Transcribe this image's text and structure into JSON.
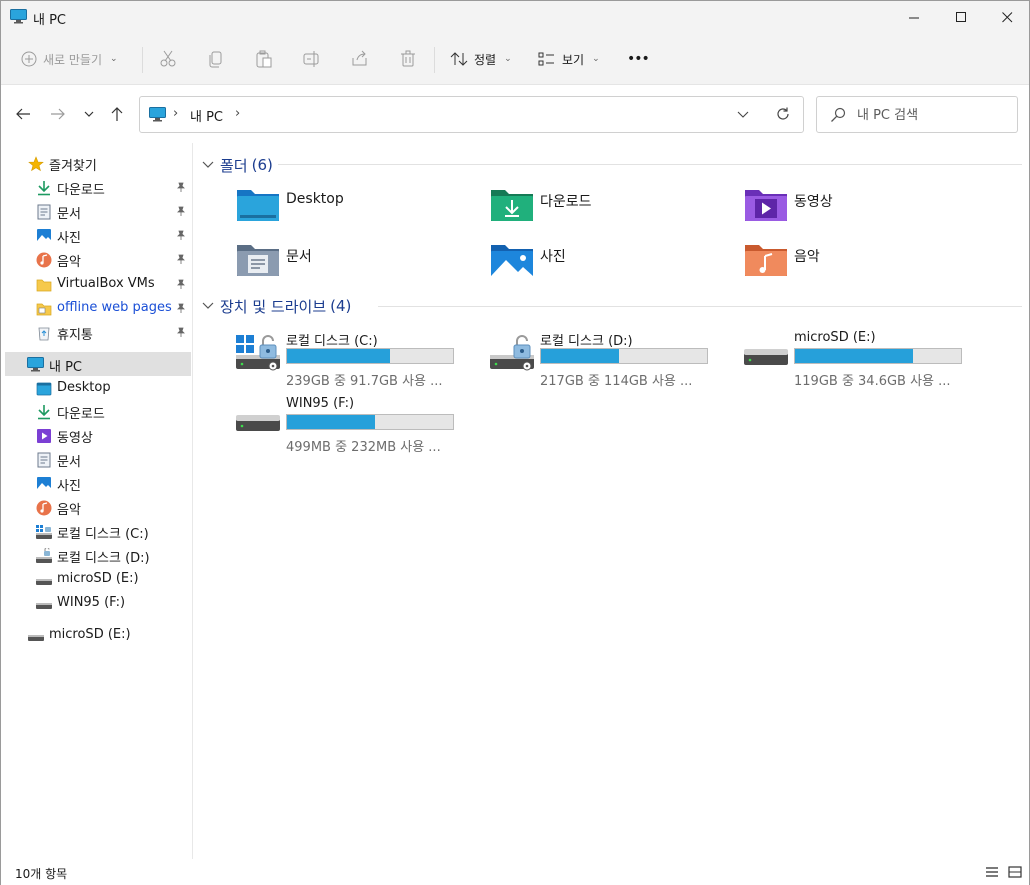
{
  "window": {
    "title": "내 PC"
  },
  "toolbar": {
    "new_label": "새로 만들기",
    "sort_label": "정렬",
    "view_label": "보기",
    "more_label": "•••"
  },
  "address": {
    "crumb": "내 PC",
    "sep": "›"
  },
  "search": {
    "placeholder": "내 PC 검색"
  },
  "sidebar": {
    "quick_access": {
      "label": "즐겨찾기",
      "items": [
        {
          "label": "다운로드",
          "icon": "download-icon"
        },
        {
          "label": "문서",
          "icon": "document-icon"
        },
        {
          "label": "사진",
          "icon": "picture-icon"
        },
        {
          "label": "음악",
          "icon": "music-icon"
        },
        {
          "label": "VirtualBox VMs",
          "icon": "folder-icon"
        },
        {
          "label": "offline web pages",
          "icon": "folder-icon"
        },
        {
          "label": "휴지통",
          "icon": "recycle-bin-icon"
        }
      ]
    },
    "this_pc": {
      "label": "내 PC",
      "items": [
        {
          "label": "Desktop",
          "icon": "desktop-icon"
        },
        {
          "label": "다운로드",
          "icon": "download-icon"
        },
        {
          "label": "동영상",
          "icon": "video-icon"
        },
        {
          "label": "문서",
          "icon": "document-icon"
        },
        {
          "label": "사진",
          "icon": "picture-icon"
        },
        {
          "label": "음악",
          "icon": "music-icon"
        },
        {
          "label": "로컬 디스크 (C:)",
          "icon": "system-drive-icon"
        },
        {
          "label": "로컬 디스크 (D:)",
          "icon": "drive-icon"
        },
        {
          "label": "microSD (E:)",
          "icon": "drive-icon"
        },
        {
          "label": "WIN95 (F:)",
          "icon": "drive-icon"
        }
      ]
    },
    "external": {
      "label": "microSD (E:)"
    }
  },
  "main": {
    "folders_group": {
      "label": "폴더",
      "count": "(6)"
    },
    "folders": [
      {
        "name": "Desktop",
        "icon": "desktop-folder-icon"
      },
      {
        "name": "다운로드",
        "icon": "downloads-folder-icon"
      },
      {
        "name": "동영상",
        "icon": "videos-folder-icon"
      },
      {
        "name": "문서",
        "icon": "documents-folder-icon"
      },
      {
        "name": "사진",
        "icon": "pictures-folder-icon"
      },
      {
        "name": "음악",
        "icon": "music-folder-icon"
      }
    ],
    "drives_group": {
      "label": "장치 및 드라이브",
      "count": "(4)"
    },
    "drives": [
      {
        "name": "로컬 디스크 (C:)",
        "info": "239GB 중 91.7GB 사용 ...",
        "used_fraction": 0.62
      },
      {
        "name": "로컬 디스크 (D:)",
        "info": "217GB 중 114GB 사용 ...",
        "used_fraction": 0.47
      },
      {
        "name": "microSD (E:)",
        "info": "119GB 중 34.6GB 사용 ...",
        "used_fraction": 0.71
      },
      {
        "name": "WIN95 (F:)",
        "info": "499MB 중 232MB 사용 ...",
        "used_fraction": 0.53
      }
    ]
  },
  "status": {
    "item_count": "10개 항목"
  },
  "colors": {
    "accent": "#26a0da",
    "group_header": "#1c3d8f",
    "link": "#1a4fd6"
  }
}
